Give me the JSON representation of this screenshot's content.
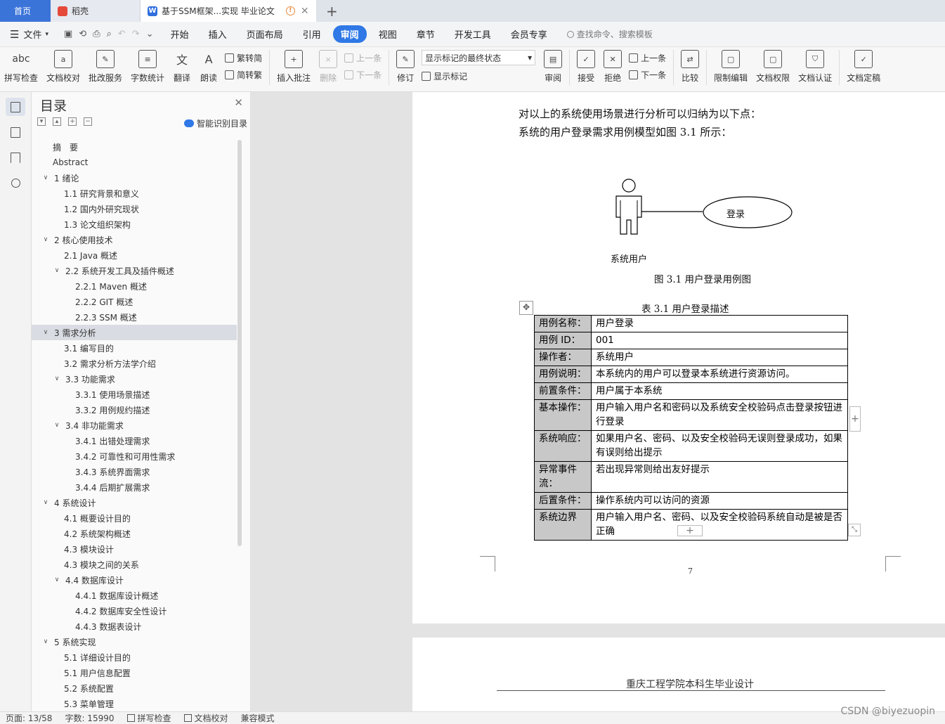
{
  "tabs": {
    "home": "首页",
    "daoke": "稻壳",
    "doc": "基于SSM框架...实现 毕业论文"
  },
  "menubar": {
    "file": "文件",
    "items": [
      "开始",
      "插入",
      "页面布局",
      "引用",
      "审阅",
      "视图",
      "章节",
      "开发工具",
      "会员专享"
    ],
    "active_index": 4,
    "search": "查找命令、搜索模板"
  },
  "ribbon": {
    "spell": "拼写检查",
    "spell_icon": "abc",
    "proof": "文档校对",
    "review_service": "批改服务",
    "wordcount": "字数统计",
    "translate": "翻译",
    "read": "朗读",
    "to_trad": "繁转简",
    "to_simp": "简转繁",
    "insert_comment": "插入批注",
    "delete": "删除",
    "prev": "上一条",
    "next": "下一条",
    "revise": "修订",
    "show_state": "显示标记的最终状态",
    "show_marks": "显示标记",
    "review": "审阅",
    "accept": "接受",
    "reject": "拒绝",
    "prev2": "上一条",
    "next2": "下一条",
    "compare": "比较",
    "restrict": "限制编辑",
    "perm": "文档权限",
    "auth": "文档认证",
    "finalize": "文档定稿"
  },
  "toc": {
    "title": "目录",
    "smart": "智能识别目录",
    "items": [
      {
        "text": "摘　要",
        "level": 0,
        "chev": false
      },
      {
        "text": "Abstract",
        "level": 0,
        "chev": false
      },
      {
        "text": "1  绪论",
        "level": 0,
        "chev": true
      },
      {
        "text": "1.1  研究背景和意义",
        "level": 1,
        "chev": false
      },
      {
        "text": "1.2  国内外研究现状",
        "level": 1,
        "chev": false
      },
      {
        "text": "1.3  论文组织架构",
        "level": 1,
        "chev": false
      },
      {
        "text": "2  核心使用技术",
        "level": 0,
        "chev": true
      },
      {
        "text": "2.1 Java 概述",
        "level": 1,
        "chev": false
      },
      {
        "text": "2.2 系统开发工具及插件概述",
        "level": 1,
        "chev": true
      },
      {
        "text": "2.2.1 Maven  概述",
        "level": 2,
        "chev": false
      },
      {
        "text": "2.2.2 GIT 概述",
        "level": 2,
        "chev": false
      },
      {
        "text": "2.2.3 SSM 概述",
        "level": 2,
        "chev": false
      },
      {
        "text": "3  需求分析",
        "level": 0,
        "chev": true,
        "active": true
      },
      {
        "text": "3.1  编写目的",
        "level": 1,
        "chev": false
      },
      {
        "text": "3.2  需求分析方法学介绍",
        "level": 1,
        "chev": false
      },
      {
        "text": "3.3 功能需求",
        "level": 1,
        "chev": true
      },
      {
        "text": "3.3.1 使用场景描述",
        "level": 2,
        "chev": false
      },
      {
        "text": "3.3.2 用例规约描述",
        "level": 2,
        "chev": false
      },
      {
        "text": "3.4  非功能需求",
        "level": 1,
        "chev": true
      },
      {
        "text": "3.4.1  出错处理需求",
        "level": 2,
        "chev": false
      },
      {
        "text": "3.4.2  可靠性和可用性需求",
        "level": 2,
        "chev": false
      },
      {
        "text": "3.4.3  系统界面需求",
        "level": 2,
        "chev": false
      },
      {
        "text": "3.4.4  后期扩展需求",
        "level": 2,
        "chev": false
      },
      {
        "text": "4  系统设计",
        "level": 0,
        "chev": true
      },
      {
        "text": "4.1  概要设计目的",
        "level": 1,
        "chev": false
      },
      {
        "text": "4.2  系统架构概述",
        "level": 1,
        "chev": false
      },
      {
        "text": "4.3  模块设计",
        "level": 1,
        "chev": false
      },
      {
        "text": "4.3  模块之间的关系",
        "level": 1,
        "chev": false
      },
      {
        "text": "4.4  数据库设计",
        "level": 1,
        "chev": true
      },
      {
        "text": "4.4.1  数据库设计概述",
        "level": 2,
        "chev": false
      },
      {
        "text": "4.4.2  数据库安全性设计",
        "level": 2,
        "chev": false
      },
      {
        "text": "4.4.3 数据表设计",
        "level": 2,
        "chev": false
      },
      {
        "text": "5  系统实现",
        "level": 0,
        "chev": true
      },
      {
        "text": "5.1  详细设计目的",
        "level": 1,
        "chev": false
      },
      {
        "text": "5.1  用户信息配置",
        "level": 1,
        "chev": false
      },
      {
        "text": "5.2  系统配置",
        "level": 1,
        "chev": false
      },
      {
        "text": "5.3  菜单管理",
        "level": 1,
        "chev": false
      }
    ]
  },
  "document": {
    "line1": "对以上的系统使用场景进行分析可以归纳为以下点：",
    "line2": "系统的用户登录需求用例模型如图  3.1  所示：",
    "actor": "系统用户",
    "usecase": "登录",
    "fig_caption": "图  3.1  用户登录用例图",
    "table_caption": "表  3.1  用户登录描述",
    "table": [
      {
        "k": "用例名称：",
        "v": "用户登录"
      },
      {
        "k": "用例 ID：",
        "v": "001"
      },
      {
        "k": "操作者：",
        "v": "系统用户"
      },
      {
        "k": "用例说明：",
        "v": "本系统内的用户可以登录本系统进行资源访问。"
      },
      {
        "k": "前置条件：",
        "v": "用户属于本系统"
      },
      {
        "k": "基本操作：",
        "v": "用户输入用户名和密码以及系统安全校验码点击登录按钮进行登录"
      },
      {
        "k": "系统响应：",
        "v": "如果用户名、密码、以及安全校验码无误则登录成功，如果有误则给出提示"
      },
      {
        "k": "异常事件流：",
        "v": "若出现异常则给出友好提示"
      },
      {
        "k": "后置条件：",
        "v": "操作系统内可以访问的资源"
      },
      {
        "k": "系统边界",
        "v": "用户输入用户名、密码、以及安全校验码系统自动是被是否正确"
      }
    ],
    "page_number": "7",
    "next_page_header": "重庆工程学院本科生毕业设计"
  },
  "status": {
    "page": "页面: 13/58",
    "words": "字数: 15990",
    "spell": "拼写检查",
    "proof": "文档校对",
    "compat": "兼容模式"
  },
  "watermark": "CSDN @biyezuopin"
}
